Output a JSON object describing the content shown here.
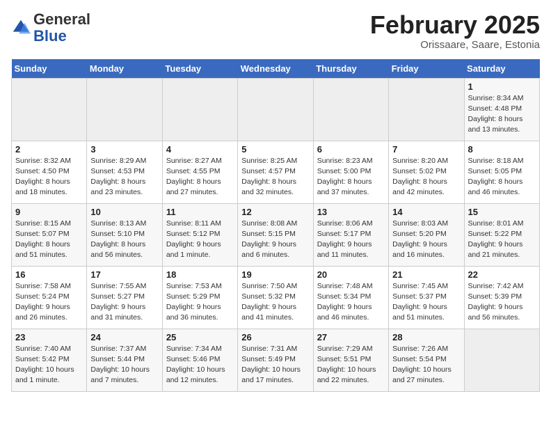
{
  "header": {
    "logo_general": "General",
    "logo_blue": "Blue",
    "month_title": "February 2025",
    "location": "Orissaare, Saare, Estonia"
  },
  "days_of_week": [
    "Sunday",
    "Monday",
    "Tuesday",
    "Wednesday",
    "Thursday",
    "Friday",
    "Saturday"
  ],
  "weeks": [
    [
      {
        "day": "",
        "info": ""
      },
      {
        "day": "",
        "info": ""
      },
      {
        "day": "",
        "info": ""
      },
      {
        "day": "",
        "info": ""
      },
      {
        "day": "",
        "info": ""
      },
      {
        "day": "",
        "info": ""
      },
      {
        "day": "1",
        "info": "Sunrise: 8:34 AM\nSunset: 4:48 PM\nDaylight: 8 hours and 13 minutes."
      }
    ],
    [
      {
        "day": "2",
        "info": "Sunrise: 8:32 AM\nSunset: 4:50 PM\nDaylight: 8 hours and 18 minutes."
      },
      {
        "day": "3",
        "info": "Sunrise: 8:29 AM\nSunset: 4:53 PM\nDaylight: 8 hours and 23 minutes."
      },
      {
        "day": "4",
        "info": "Sunrise: 8:27 AM\nSunset: 4:55 PM\nDaylight: 8 hours and 27 minutes."
      },
      {
        "day": "5",
        "info": "Sunrise: 8:25 AM\nSunset: 4:57 PM\nDaylight: 8 hours and 32 minutes."
      },
      {
        "day": "6",
        "info": "Sunrise: 8:23 AM\nSunset: 5:00 PM\nDaylight: 8 hours and 37 minutes."
      },
      {
        "day": "7",
        "info": "Sunrise: 8:20 AM\nSunset: 5:02 PM\nDaylight: 8 hours and 42 minutes."
      },
      {
        "day": "8",
        "info": "Sunrise: 8:18 AM\nSunset: 5:05 PM\nDaylight: 8 hours and 46 minutes."
      }
    ],
    [
      {
        "day": "9",
        "info": "Sunrise: 8:15 AM\nSunset: 5:07 PM\nDaylight: 8 hours and 51 minutes."
      },
      {
        "day": "10",
        "info": "Sunrise: 8:13 AM\nSunset: 5:10 PM\nDaylight: 8 hours and 56 minutes."
      },
      {
        "day": "11",
        "info": "Sunrise: 8:11 AM\nSunset: 5:12 PM\nDaylight: 9 hours and 1 minute."
      },
      {
        "day": "12",
        "info": "Sunrise: 8:08 AM\nSunset: 5:15 PM\nDaylight: 9 hours and 6 minutes."
      },
      {
        "day": "13",
        "info": "Sunrise: 8:06 AM\nSunset: 5:17 PM\nDaylight: 9 hours and 11 minutes."
      },
      {
        "day": "14",
        "info": "Sunrise: 8:03 AM\nSunset: 5:20 PM\nDaylight: 9 hours and 16 minutes."
      },
      {
        "day": "15",
        "info": "Sunrise: 8:01 AM\nSunset: 5:22 PM\nDaylight: 9 hours and 21 minutes."
      }
    ],
    [
      {
        "day": "16",
        "info": "Sunrise: 7:58 AM\nSunset: 5:24 PM\nDaylight: 9 hours and 26 minutes."
      },
      {
        "day": "17",
        "info": "Sunrise: 7:55 AM\nSunset: 5:27 PM\nDaylight: 9 hours and 31 minutes."
      },
      {
        "day": "18",
        "info": "Sunrise: 7:53 AM\nSunset: 5:29 PM\nDaylight: 9 hours and 36 minutes."
      },
      {
        "day": "19",
        "info": "Sunrise: 7:50 AM\nSunset: 5:32 PM\nDaylight: 9 hours and 41 minutes."
      },
      {
        "day": "20",
        "info": "Sunrise: 7:48 AM\nSunset: 5:34 PM\nDaylight: 9 hours and 46 minutes."
      },
      {
        "day": "21",
        "info": "Sunrise: 7:45 AM\nSunset: 5:37 PM\nDaylight: 9 hours and 51 minutes."
      },
      {
        "day": "22",
        "info": "Sunrise: 7:42 AM\nSunset: 5:39 PM\nDaylight: 9 hours and 56 minutes."
      }
    ],
    [
      {
        "day": "23",
        "info": "Sunrise: 7:40 AM\nSunset: 5:42 PM\nDaylight: 10 hours and 1 minute."
      },
      {
        "day": "24",
        "info": "Sunrise: 7:37 AM\nSunset: 5:44 PM\nDaylight: 10 hours and 7 minutes."
      },
      {
        "day": "25",
        "info": "Sunrise: 7:34 AM\nSunset: 5:46 PM\nDaylight: 10 hours and 12 minutes."
      },
      {
        "day": "26",
        "info": "Sunrise: 7:31 AM\nSunset: 5:49 PM\nDaylight: 10 hours and 17 minutes."
      },
      {
        "day": "27",
        "info": "Sunrise: 7:29 AM\nSunset: 5:51 PM\nDaylight: 10 hours and 22 minutes."
      },
      {
        "day": "28",
        "info": "Sunrise: 7:26 AM\nSunset: 5:54 PM\nDaylight: 10 hours and 27 minutes."
      },
      {
        "day": "",
        "info": ""
      }
    ]
  ]
}
